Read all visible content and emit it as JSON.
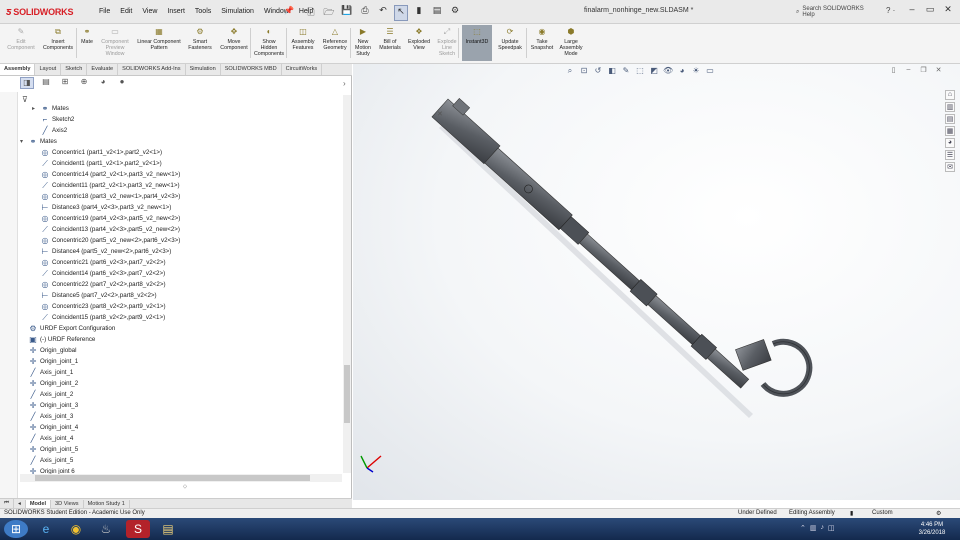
{
  "app": {
    "brand": "SOLIDWORKS",
    "menus": [
      "File",
      "Edit",
      "View",
      "Insert",
      "Tools",
      "Simulation",
      "Window",
      "Help"
    ],
    "filename": "finalarm_nonhinge_new.SLDASM *",
    "search_label": "Search SOLIDWORKS Help",
    "help_label": "? ·"
  },
  "commands": [
    {
      "label": "Edit Component",
      "state": "disabled",
      "icon": "edit-component-icon",
      "glyph": "✎"
    },
    {
      "label": "Insert Components",
      "state": "enabled",
      "icon": "insert-components-icon",
      "glyph": "⧉"
    },
    {
      "label": "Mate",
      "state": "enabled",
      "icon": "mate-icon",
      "glyph": "⚭"
    },
    {
      "label": "Component Preview Window",
      "state": "disabled",
      "icon": "preview-window-icon",
      "glyph": "▭"
    },
    {
      "label": "Linear Component Pattern",
      "state": "enabled",
      "icon": "linear-pattern-icon",
      "glyph": "▦"
    },
    {
      "label": "Smart Fasteners",
      "state": "enabled",
      "icon": "fasteners-icon",
      "glyph": "⚙"
    },
    {
      "label": "Move Component",
      "state": "enabled",
      "icon": "move-component-icon",
      "glyph": "✥"
    },
    {
      "label": "Show Hidden Components",
      "state": "enabled",
      "icon": "show-hidden-icon",
      "glyph": "◐"
    },
    {
      "label": "Assembly Features",
      "state": "enabled",
      "icon": "assembly-features-icon",
      "glyph": "◫"
    },
    {
      "label": "Reference Geometry",
      "state": "enabled",
      "icon": "reference-geometry-icon",
      "glyph": "△"
    },
    {
      "label": "New Motion Study",
      "state": "enabled",
      "icon": "motion-study-icon",
      "glyph": "▶"
    },
    {
      "label": "Bill of Materials",
      "state": "enabled",
      "icon": "bom-icon",
      "glyph": "☰"
    },
    {
      "label": "Exploded View",
      "state": "enabled",
      "icon": "exploded-view-icon",
      "glyph": "❖"
    },
    {
      "label": "Explode Line Sketch",
      "state": "disabled",
      "icon": "explode-line-icon",
      "glyph": "⤢"
    },
    {
      "label": "Instant3D",
      "state": "active",
      "icon": "instant3d-icon",
      "glyph": "⬚"
    },
    {
      "label": "Update Speedpak",
      "state": "enabled",
      "icon": "speedpak-icon",
      "glyph": "⟳"
    },
    {
      "label": "Take Snapshot",
      "state": "enabled",
      "icon": "snapshot-icon",
      "glyph": "◉"
    },
    {
      "label": "Large Assembly Mode",
      "state": "enabled",
      "icon": "large-assembly-icon",
      "glyph": "⬢"
    }
  ],
  "tabs": [
    "Assembly",
    "Layout",
    "Sketch",
    "Evaluate",
    "SOLIDWORKS Add-Ins",
    "Simulation",
    "SOLIDWORKS MBD",
    "CircuitWorks"
  ],
  "tree": [
    {
      "label": "Mates",
      "icon": "mates-icon",
      "glyph": "⚭",
      "indent": 1,
      "exp": "▸"
    },
    {
      "label": "Sketch2",
      "icon": "sketch-icon",
      "glyph": "⌐",
      "indent": 1,
      "exp": ""
    },
    {
      "label": "Axis2",
      "icon": "axis-icon",
      "glyph": "╱",
      "indent": 1,
      "exp": ""
    },
    {
      "label": "Mates",
      "icon": "mates-icon",
      "glyph": "⚭",
      "indent": 0,
      "exp": "▾"
    },
    {
      "label": "Concentric1 (part1_v2<1>,part2_v2<1>)",
      "icon": "concentric-mate-icon",
      "glyph": "◎",
      "indent": 1,
      "exp": ""
    },
    {
      "label": "Coincident1 (part1_v2<1>,part2_v2<1>)",
      "icon": "coincident-mate-icon",
      "glyph": "⟋",
      "indent": 1,
      "exp": ""
    },
    {
      "label": "Concentric14 (part2_v2<1>,part3_v2_new<1>)",
      "icon": "concentric-mate-icon",
      "glyph": "◎",
      "indent": 1,
      "exp": ""
    },
    {
      "label": "Coincident11 (part2_v2<1>,part3_v2_new<1>)",
      "icon": "coincident-mate-icon",
      "glyph": "⟋",
      "indent": 1,
      "exp": ""
    },
    {
      "label": "Concentric18 (part3_v2_new<1>,part4_v2<3>)",
      "icon": "concentric-mate-icon",
      "glyph": "◎",
      "indent": 1,
      "exp": ""
    },
    {
      "label": "Distance3 (part4_v2<3>,part3_v2_new<1>)",
      "icon": "distance-mate-icon",
      "glyph": "⊢",
      "indent": 1,
      "exp": ""
    },
    {
      "label": "Concentric19 (part4_v2<3>,part5_v2_new<2>)",
      "icon": "concentric-mate-icon",
      "glyph": "◎",
      "indent": 1,
      "exp": ""
    },
    {
      "label": "Coincident13 (part4_v2<3>,part5_v2_new<2>)",
      "icon": "coincident-mate-icon",
      "glyph": "⟋",
      "indent": 1,
      "exp": ""
    },
    {
      "label": "Concentric20 (part5_v2_new<2>,part6_v2<3>)",
      "icon": "concentric-mate-icon",
      "glyph": "◎",
      "indent": 1,
      "exp": ""
    },
    {
      "label": "Distance4 (part5_v2_new<2>,part6_v2<3>)",
      "icon": "distance-mate-icon",
      "glyph": "⊢",
      "indent": 1,
      "exp": ""
    },
    {
      "label": "Concentric21 (part6_v2<3>,part7_v2<2>)",
      "icon": "concentric-mate-icon",
      "glyph": "◎",
      "indent": 1,
      "exp": ""
    },
    {
      "label": "Coincident14 (part6_v2<3>,part7_v2<2>)",
      "icon": "coincident-mate-icon",
      "glyph": "⟋",
      "indent": 1,
      "exp": ""
    },
    {
      "label": "Concentric22 (part7_v2<2>,part8_v2<2>)",
      "icon": "concentric-mate-icon",
      "glyph": "◎",
      "indent": 1,
      "exp": ""
    },
    {
      "label": "Distance5 (part7_v2<2>,part8_v2<2>)",
      "icon": "distance-mate-icon",
      "glyph": "⊢",
      "indent": 1,
      "exp": ""
    },
    {
      "label": "Concentric23 (part8_v2<2>,part9_v2<1>)",
      "icon": "concentric-mate-icon",
      "glyph": "◎",
      "indent": 1,
      "exp": ""
    },
    {
      "label": "Coincident15 (part8_v2<2>,part9_v2<1>)",
      "icon": "coincident-mate-icon",
      "glyph": "⟋",
      "indent": 1,
      "exp": ""
    },
    {
      "label": "URDF Export Configuration",
      "icon": "urdf-config-icon",
      "glyph": "⚙",
      "indent": 0,
      "exp": ""
    },
    {
      "label": "(-) URDF Reference",
      "icon": "urdf-reference-icon",
      "glyph": "▣",
      "indent": 0,
      "exp": ""
    },
    {
      "label": "Origin_global",
      "icon": "origin-icon",
      "glyph": "✛",
      "indent": 0,
      "exp": ""
    },
    {
      "label": "Origin_joint_1",
      "icon": "origin-icon",
      "glyph": "✛",
      "indent": 0,
      "exp": ""
    },
    {
      "label": "Axis_joint_1",
      "icon": "axis-icon",
      "glyph": "╱",
      "indent": 0,
      "exp": ""
    },
    {
      "label": "Origin_joint_2",
      "icon": "origin-icon",
      "glyph": "✛",
      "indent": 0,
      "exp": ""
    },
    {
      "label": "Axis_joint_2",
      "icon": "axis-icon",
      "glyph": "╱",
      "indent": 0,
      "exp": ""
    },
    {
      "label": "Origin_joint_3",
      "icon": "origin-icon",
      "glyph": "✛",
      "indent": 0,
      "exp": ""
    },
    {
      "label": "Axis_joint_3",
      "icon": "axis-icon",
      "glyph": "╱",
      "indent": 0,
      "exp": ""
    },
    {
      "label": "Origin_joint_4",
      "icon": "origin-icon",
      "glyph": "✛",
      "indent": 0,
      "exp": ""
    },
    {
      "label": "Axis_joint_4",
      "icon": "axis-icon",
      "glyph": "╱",
      "indent": 0,
      "exp": ""
    },
    {
      "label": "Origin_joint_5",
      "icon": "origin-icon",
      "glyph": "✛",
      "indent": 0,
      "exp": ""
    },
    {
      "label": "Axis_joint_5",
      "icon": "axis-icon",
      "glyph": "╱",
      "indent": 0,
      "exp": ""
    },
    {
      "label": "Origin joint 6",
      "icon": "origin-icon",
      "glyph": "✛",
      "indent": 0,
      "exp": ""
    }
  ],
  "bottom_tabs": [
    "Model",
    "3D Views",
    "Motion Study 1"
  ],
  "status": {
    "edition": "SOLIDWORKS Student Edition - Academic Use Only",
    "definition": "Under Defined",
    "mode": "Editing Assembly",
    "units": "Custom"
  },
  "taskbar": {
    "time": "4:46 PM",
    "date": "3/26/2018"
  },
  "colors": {
    "brand": "#d71f26",
    "active_command": "#9aa3ad",
    "taskbar": "#1d3863"
  }
}
